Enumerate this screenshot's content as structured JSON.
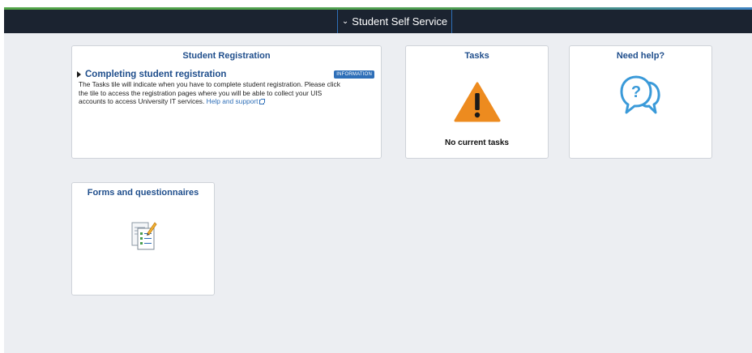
{
  "navbar": {
    "title": "Student Self Service",
    "chevron_icon": "chevron-down-icon"
  },
  "tiles": {
    "student_registration": {
      "title": "Student Registration",
      "heading": "Completing student registration",
      "badge": "INFORMATION",
      "body_line1": "The Tasks tile will indicate when you have to complete student registration. Please click",
      "body_line2": "the tile to access the registration pages where you will be able to collect your UIS",
      "body_line3_prefix": "accounts to access University IT services.",
      "link_text": "Help and support",
      "link_icon": "external-link-icon"
    },
    "tasks": {
      "title": "Tasks",
      "icon": "warning-icon",
      "empty_text": "No current tasks"
    },
    "need_help": {
      "title": "Need help?",
      "icon": "chat-question-icon"
    },
    "forms": {
      "title": "Forms and questionnaires",
      "icon": "form-checklist-icon"
    }
  },
  "colors": {
    "navbar_bg": "#1b2330",
    "title_blue": "#1f4e8c",
    "accent_blue": "#2e6fb8",
    "warning_orange": "#ed8b1f",
    "help_blue": "#3a9ad9",
    "content_bg": "#eceef2"
  }
}
